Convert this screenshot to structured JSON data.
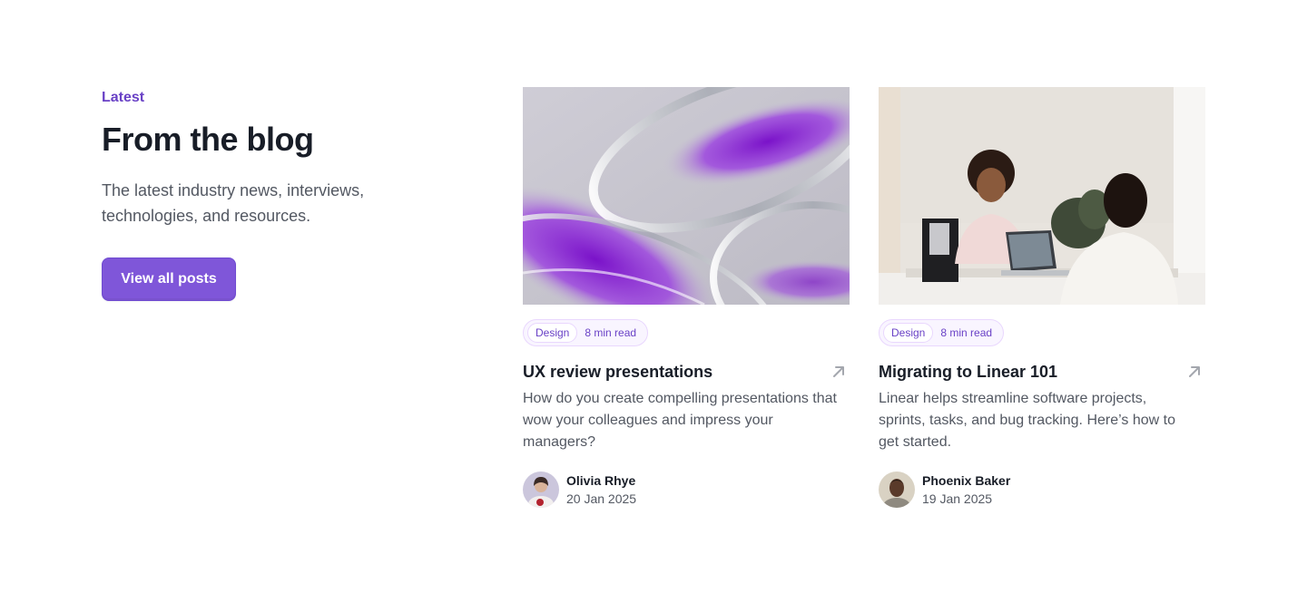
{
  "intro": {
    "eyebrow": "Latest",
    "heading": "From the blog",
    "subtext": "The latest industry news, interviews, technologies, and resources.",
    "cta_label": "View all posts"
  },
  "posts": [
    {
      "image": "abstract-glass-purple",
      "tag": "Design",
      "read_time": "8 min read",
      "title": "UX review presentations",
      "excerpt": "How do you create compelling presentations that wow your colleagues and impress your managers?",
      "author_name": "Olivia Rhye",
      "date": "20 Jan 2025",
      "arrow_icon": "arrow-up-right-icon"
    },
    {
      "image": "office-meeting",
      "tag": "Design",
      "read_time": "8 min read",
      "title": "Migrating to Linear 101",
      "excerpt": "Linear helps streamline software projects, sprints, tasks, and bug tracking. Here’s how to get started.",
      "author_name": "Phoenix Baker",
      "date": "19 Jan 2025",
      "arrow_icon": "arrow-up-right-icon"
    }
  ],
  "colors": {
    "brand": "#7f56d9",
    "brand_text": "#6941c6",
    "heading": "#181d27",
    "body": "#535862"
  }
}
